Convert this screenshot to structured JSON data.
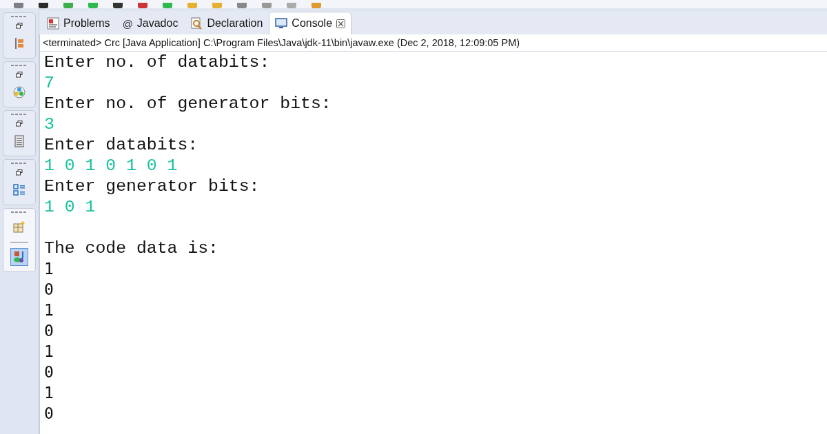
{
  "sidebar": {
    "groups": [
      {
        "minimized": true,
        "icons": [
          {
            "kind": "hierarchy",
            "selected": false
          }
        ]
      },
      {
        "minimized": true,
        "icons": [
          {
            "kind": "palette",
            "selected": false
          }
        ]
      },
      {
        "minimized": true,
        "icons": [
          {
            "kind": "document",
            "selected": false
          }
        ]
      },
      {
        "minimized": true,
        "icons": [
          {
            "kind": "outline",
            "selected": false
          }
        ]
      },
      {
        "minimized": false,
        "icons": [
          {
            "kind": "grid",
            "selected": false
          },
          {
            "kind": "perspective",
            "selected": true
          }
        ]
      }
    ]
  },
  "tabs": [
    {
      "label": "Problems",
      "kind": "problems",
      "selected": false
    },
    {
      "label": "Javadoc",
      "kind": "glyph",
      "glyph": "@",
      "selected": false
    },
    {
      "label": "Declaration",
      "kind": "declaration",
      "selected": false
    },
    {
      "label": "Console",
      "kind": "console",
      "selected": true,
      "closable": true
    }
  ],
  "status": "<terminated> Crc [Java Application] C:\\Program Files\\Java\\jdk-11\\bin\\javaw.exe (Dec 2, 2018, 12:09:05 PM)",
  "console": [
    {
      "kind": "prompt",
      "text": "Enter no. of databits:"
    },
    {
      "kind": "input",
      "text": "7"
    },
    {
      "kind": "prompt",
      "text": "Enter no. of generator bits:"
    },
    {
      "kind": "input",
      "text": "3"
    },
    {
      "kind": "prompt",
      "text": "Enter databits:"
    },
    {
      "kind": "input",
      "text": "1 0 1 0 1 0 1"
    },
    {
      "kind": "prompt",
      "text": "Enter generator bits:"
    },
    {
      "kind": "input",
      "text": "1 0 1"
    },
    {
      "kind": "blank"
    },
    {
      "kind": "prompt",
      "text": "The code data is:"
    },
    {
      "kind": "output",
      "text": "1"
    },
    {
      "kind": "output",
      "text": "0"
    },
    {
      "kind": "output",
      "text": "1"
    },
    {
      "kind": "output",
      "text": "0"
    },
    {
      "kind": "output",
      "text": "1"
    },
    {
      "kind": "output",
      "text": "0"
    },
    {
      "kind": "output",
      "text": "1"
    },
    {
      "kind": "output",
      "text": "0"
    }
  ]
}
